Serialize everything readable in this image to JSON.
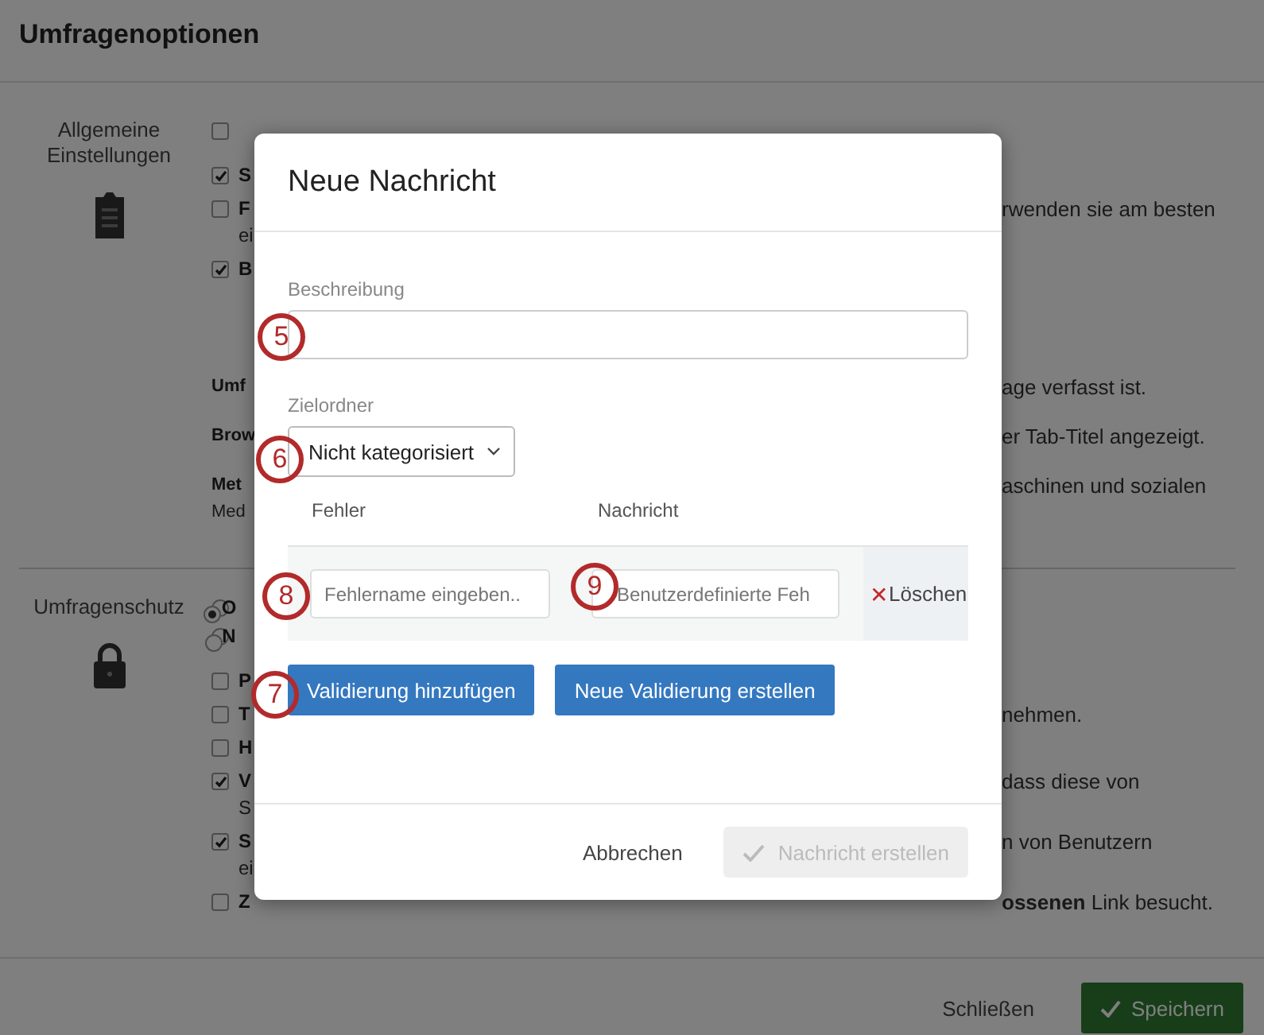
{
  "page": {
    "title": "Umfragenoptionen"
  },
  "sections": [
    {
      "label": "Allgemeine Einstellungen",
      "rows": [
        {
          "kind": "checkbox",
          "checked": false
        },
        {
          "kind": "checkbox",
          "checked": true,
          "title": "S"
        },
        {
          "kind": "checkbox",
          "checked": false,
          "title": "F",
          "continuation": "ei",
          "right": "rwenden sie am besten"
        },
        {
          "kind": "checkbox",
          "checked": true,
          "title": "B"
        },
        {
          "kind": "text",
          "title": "Umf",
          "right": "age verfasst ist."
        },
        {
          "kind": "text",
          "title": "Brow",
          "right": "er Tab-Titel angezeigt."
        },
        {
          "kind": "text",
          "title": "Met",
          "continuation": "Med",
          "right": "aschinen und sozialen"
        }
      ]
    },
    {
      "label": "Umfragenschutz",
      "rows": [
        {
          "kind": "radio",
          "selected": true,
          "title": "O"
        },
        {
          "kind": "radio",
          "selected": false,
          "title": "N"
        },
        {
          "kind": "checkbox",
          "checked": false,
          "title": "P"
        },
        {
          "kind": "checkbox",
          "checked": false,
          "title": "T",
          "right": "nehmen."
        },
        {
          "kind": "checkbox",
          "checked": false,
          "title": "H"
        },
        {
          "kind": "checkbox",
          "checked": true,
          "title": "V",
          "continuation": "S",
          "right": "dass diese von"
        },
        {
          "kind": "checkbox",
          "checked": true,
          "title": "S",
          "continuation": "ei",
          "right": "n von Benutzern"
        },
        {
          "kind": "checkbox",
          "checked": false,
          "title": "Z",
          "right": "**ossenen** Link besucht."
        }
      ]
    }
  ],
  "footer": {
    "close": "Schließen",
    "save": "Speichern"
  },
  "dialog": {
    "title": "Neue Nachricht",
    "description": {
      "label": "Beschreibung"
    },
    "folder": {
      "label": "Zielordner",
      "value": "Nicht kategorisiert"
    },
    "table": {
      "columns": [
        "Fehler",
        "Nachricht"
      ],
      "rows": [
        {
          "error_placeholder": "Fehlername eingeben..",
          "message_placeholder": "Benutzerdefinierte Feh",
          "delete_icon": "✕",
          "delete": "Löschen"
        }
      ]
    },
    "buttons": [
      "Validierung hinzufügen",
      "Neue Validierung erstellen"
    ],
    "cancel": "Abbrechen",
    "submit": {
      "label": "Nachricht erstellen",
      "disabled": true
    }
  },
  "callouts": [
    {
      "label": "5"
    },
    {
      "label": "6"
    },
    {
      "label": "8"
    },
    {
      "label": "9"
    },
    {
      "label": "7"
    }
  ]
}
